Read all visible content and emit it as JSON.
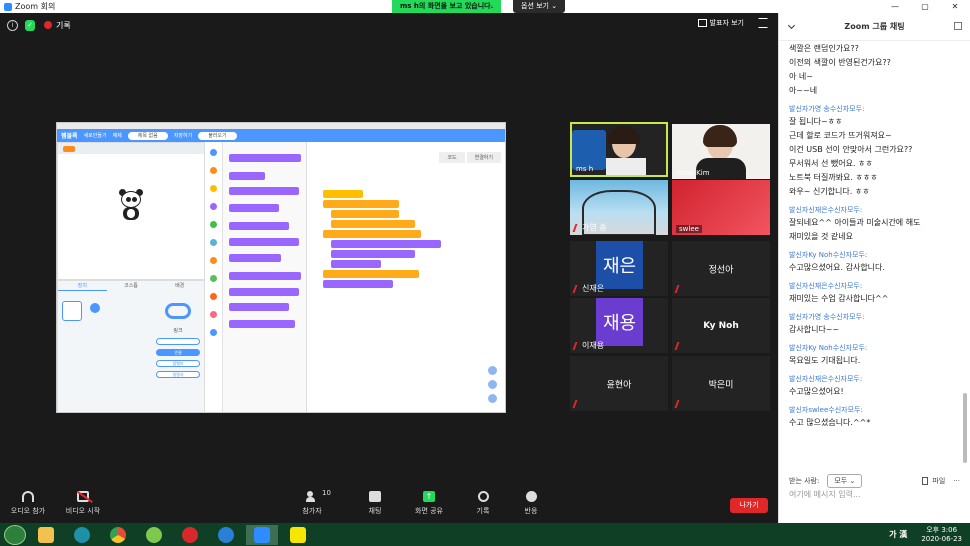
{
  "window": {
    "title": "Zoom 회의",
    "minimize_glyph": "—",
    "restore_glyph": "▢",
    "close_glyph": "✕"
  },
  "share_banner": "ms h의 화면을 보고 있습니다.",
  "view_options": "옵션 보기 ⌄",
  "top_strip": {
    "info_icon": "i",
    "record_label": "기록",
    "speaker_view": "발표자 보기"
  },
  "shared_screen": {
    "brand": "햄블록",
    "menu": [
      "새로만들기",
      "예제",
      "저장하기",
      "불러오기"
    ],
    "project_name": "제목 없음",
    "tabs": [
      "장치",
      "코스튬",
      "배경"
    ],
    "link_title": "링크",
    "link_buttons": [
      "연결",
      "펌웨어",
      "설명서"
    ],
    "workspace_tabs": [
      "코드",
      "연결하기"
    ]
  },
  "participants": [
    {
      "name": "ms h",
      "video": true
    },
    {
      "name": "Anna Kim",
      "video": true
    },
    {
      "name": "가영 송",
      "video": true,
      "muted": true
    },
    {
      "name": "swlee",
      "video": true
    },
    {
      "name": "신재은",
      "avatar_text": "재은",
      "avatar_color": "#1d4fa8",
      "muted": true
    },
    {
      "name": "정선아",
      "muted": true
    },
    {
      "name": "이재용",
      "avatar_text": "재용",
      "avatar_color": "#6a3ccf",
      "muted": true
    },
    {
      "name": "Ky Noh",
      "muted": true
    },
    {
      "name": "윤현아",
      "muted": true
    },
    {
      "name": "박은미",
      "muted": true
    }
  ],
  "chat": {
    "title": "Zoom 그룹 채팅",
    "messages": [
      {
        "lines": [
          "색깔은 랜덤인가요??",
          "이전의 색깔이 반영된건가요??",
          "아 네~",
          "아~~네"
        ]
      },
      {
        "sender": "발신자가영 송수신자모두:",
        "lines": [
          "잘 됩니다~ㅎㅎ",
          "근데 할로 코드가 뜨거워져요~",
          "이건 USB 선이 안맞아서 그런가요??",
          "무서워서 선 뺐어요. ㅎㅎ",
          "노트북 터질까봐요. ㅎㅎㅎ",
          "와우~ 신기합니다. ㅎㅎ"
        ]
      },
      {
        "sender": "발신자신재은수신자모두:",
        "lines": [
          "잘되네요^^ 아이들과 미술시간에 해도",
          "재미있을 것 같네요"
        ]
      },
      {
        "sender": "발신자Ky Noh수신자모두:",
        "lines": [
          "수고많으셨어요. 감사합니다."
        ]
      },
      {
        "sender": "발신자신재은수신자모두:",
        "lines": [
          "재미있는 수업 감사합니다^^"
        ]
      },
      {
        "sender": "발신자가영 송수신자모두:",
        "lines": [
          "감사합니다~~"
        ]
      },
      {
        "sender": "발신자Ky Noh수신자모두:",
        "lines": [
          "목요일도 기대됩니다."
        ]
      },
      {
        "sender": "발신자신재은수신자모두:",
        "lines": [
          "수고많으셨어요!"
        ]
      },
      {
        "sender": "발신자swlee수신자모두:",
        "lines": [
          "수고 많으셨습니다.^^*"
        ]
      }
    ],
    "to_label": "받는 사람:",
    "to_value": "모두 ⌄",
    "file_label": "파일",
    "more_label": "···",
    "input_placeholder": "여기에 메시지 입력..."
  },
  "toolbar": {
    "audio": "오디오 참가",
    "video": "비디오 시작",
    "participants": "참가자",
    "participants_count": "10",
    "chat": "채팅",
    "share": "화면 공유",
    "record": "기록",
    "reactions": "반응",
    "leave": "나가기"
  },
  "taskbar": {
    "ime": "가 漢",
    "time": "오후 3:06",
    "date": "2020-06-23",
    "apps": [
      {
        "name": "folder-icon",
        "color": "#f2c14e"
      },
      {
        "name": "media-player-icon",
        "color": "#1e90a8"
      },
      {
        "name": "chrome-icon",
        "color": "#e84a3a"
      },
      {
        "name": "paint-icon",
        "color": "#7ec850"
      },
      {
        "name": "ez-icon",
        "color": "#d8282b"
      },
      {
        "name": "ie-icon",
        "color": "#2a7fd6"
      },
      {
        "name": "zoom-icon",
        "color": "#2d8cff"
      },
      {
        "name": "kakaotalk-icon",
        "color": "#f7e600"
      }
    ]
  }
}
